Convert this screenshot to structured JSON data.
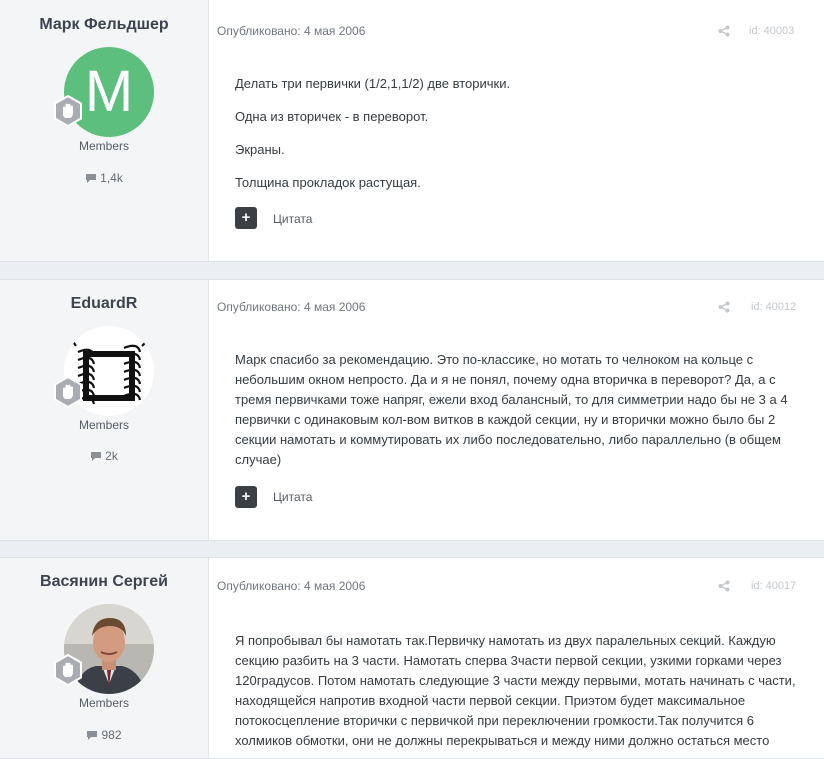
{
  "colors": {
    "page_bg": "#ebeef2",
    "author_bg": "#f4f5f7",
    "avatar_green": "#5dbf7d",
    "quote_button": "#3c3f44"
  },
  "posts": [
    {
      "author": "Марк Фельдшер",
      "avatar_letter": "M",
      "group": "Members",
      "post_count": "1,4k",
      "published": "Опубликовано: 4 мая 2006",
      "post_id": "id: 40003",
      "paragraphs": [
        "Делать три первички (1/2,1,1/2) две вторички.",
        "Одна из вторичек - в переворот.",
        "Экраны.",
        "Толщина прокладок растущая."
      ],
      "quote_label": "Цитата"
    },
    {
      "author": "EduardR",
      "group": "Members",
      "post_count": "2k",
      "published": "Опубликовано: 4 мая 2006",
      "post_id": "id: 40012",
      "paragraphs": [
        "Марк спасибо за рекомендацию. Это по-классике, но мотать то челноком на кольце с небольшим окном непросто. Да и я не понял, почему одна вторичка в переворот? Да, а с тремя первичками тоже напряг, ежели вход балансный, то для симметрии надо бы не 3 а 4 первички с одинаковым кол-вом витков в каждой секции, ну и вторички можно было бы 2 секции намотать и коммутировать их либо последовательно, либо параллельно (в общем случае)"
      ],
      "quote_label": "Цитата"
    },
    {
      "author": "Васянин Сергей",
      "group": "Members",
      "post_count": "982",
      "published": "Опубликовано: 4 мая 2006",
      "post_id": "id: 40017",
      "paragraphs": [
        "Я попробывал бы намотать так.Первичку намотать из двух паралельных секций. Каждую секцию разбить на 3 части. Намотать сперва 3части первой секции, узкими горками через 120градусов. Потом намотать следующие 3 части между первыми, мотать начинать с части, находящейся напротив входной части первой секции. Приэтом будет максимальное потокосцепление вторички с первичкой при переключении громкости.Так получится 6 холмиков обмотки, они не должны перекрываться и между ними должно остаться место"
      ]
    }
  ]
}
